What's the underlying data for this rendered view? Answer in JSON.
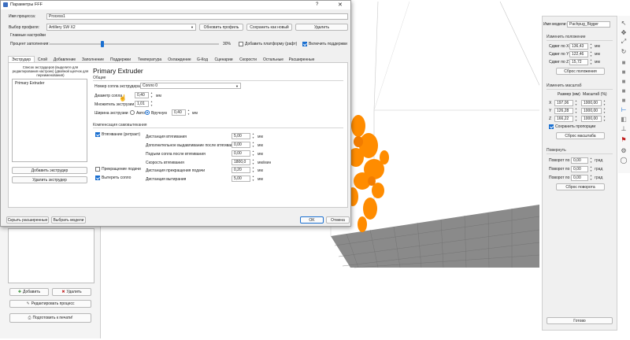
{
  "dialog": {
    "title": "Параметры FFF",
    "help": "?",
    "close": "✕",
    "process_name_label": "Имя процесса:",
    "process_name_value": "Process1",
    "profile_label": "Выбор профиля:",
    "profile_value": "Artillery SW X2",
    "update_profile_btn": "Обновить профиль",
    "save_as_new_btn": "Сохранить как новый",
    "delete_btn": "Удалить",
    "main_settings_label": "Главные настройки",
    "infill_label": "Процент заполнения:",
    "infill_percent": "30%",
    "infill_fraction": 0.3,
    "raft_label": "Добавить платформу (рафт)",
    "supports_label": "Включить поддержки",
    "tabs": [
      "Экструдер",
      "Слой",
      "Добавление",
      "Заполнение",
      "Поддержки",
      "Температура",
      "Охлаждение",
      "G-Код",
      "Сценарии",
      "Скорости",
      "Остальные",
      "Расширенные"
    ],
    "extruder_list_caption": "Список экструдеров (выделите для редактирования настроек) (двойной щелчок для переименования)",
    "extruder_item": "Primary Extruder",
    "add_extruder_btn": "Добавить экструдер",
    "remove_extruder_btn": "Удалить экструдер",
    "panel_title": "Primary Extruder",
    "general_section": "Общие",
    "nozzle_number_label": "Номер сопла экструдера",
    "nozzle_number_value": "Сопло 0",
    "nozzle_diameter_label": "Диаметр сопла",
    "nozzle_diameter_value": "0,40",
    "unit_mm": "мм",
    "extrusion_mult_label": "Множитель экструзии",
    "extrusion_mult_value": "1,01",
    "extrusion_width_label": "Ширина экструзии",
    "auto_label": "Авто",
    "manual_label": "Вручную",
    "extrusion_width_value": "0,40",
    "ooze_section": "Компенсация самовытекания",
    "retract_label": "Втягивание (ретракт)",
    "retract_distance_label": "Дистанция втягивания",
    "retract_distance_value": "5,00",
    "extra_restart_label": "Дополнительное выдавливание после втягивания",
    "extra_restart_value": "0,00",
    "lift_label": "Подъем сопла после втягивания",
    "lift_value": "0,00",
    "retract_speed_label": "Скорость втягивания",
    "retract_speed_value": "1800,0",
    "unit_mm_min": "мм/мин",
    "coast_label": "Прекращение подачи",
    "coast_distance_label": "Дистанция прекращения подачи",
    "coast_distance_value": "0,20",
    "wipe_label": "Вытереть сопло",
    "wipe_distance_label": "Дистанция вытирания",
    "wipe_distance_value": "5,00",
    "hide_advanced_btn": "Скрыть расширенные",
    "select_models_btn": "Выбрать модели",
    "ok_btn": "OK",
    "cancel_btn": "Отмена"
  },
  "left_panel": {
    "add_btn": "Добавить",
    "delete_btn": "Удалить",
    "edit_process_btn": "Редактировать процесс",
    "prepare_print_btn": "Подготовить к печати!"
  },
  "right_panel": {
    "model_name_label": "Имя модели:",
    "model_name_value": "Pachpug_Bigger",
    "position_section": "Изменить положение",
    "shift_x_label": "Сдвиг по X",
    "shift_x_value": "136,43",
    "shift_y_label": "Сдвиг по Y",
    "shift_y_value": "122,46",
    "shift_z_label": "Сдвиг по Z",
    "shift_z_value": "15,72",
    "unit_mm": "мм",
    "reset_position_btn": "Сброс положения",
    "scale_section": "Изменить масштаб",
    "size_header": "Размер (мм)",
    "scale_header": "Масштаб (%)",
    "axes": [
      "X",
      "Y",
      "Z"
    ],
    "sizes": [
      "197,06",
      "126,28",
      "166,22"
    ],
    "scales": [
      "1000,00",
      "1000,00",
      "1000,00"
    ],
    "keep_proportions_label": "Сохранить пропорции",
    "reset_scale_btn": "Сброс масштаба",
    "rotate_section": "Повернуть",
    "rot_x_label": "Поворот по X",
    "rot_x_value": "0,00",
    "rot_y_label": "Поворот по Y",
    "rot_y_value": "0,00",
    "rot_z_label": "Поворот по Z",
    "rot_z_value": "0,00",
    "unit_deg": "град",
    "reset_rotation_btn": "Сброс поворота",
    "done_btn": "Готово"
  },
  "colors": {
    "model": "#ff8c00",
    "bed": "#8a8a8a",
    "accent": "#1a6fd0",
    "viewport": "#ffffff"
  }
}
